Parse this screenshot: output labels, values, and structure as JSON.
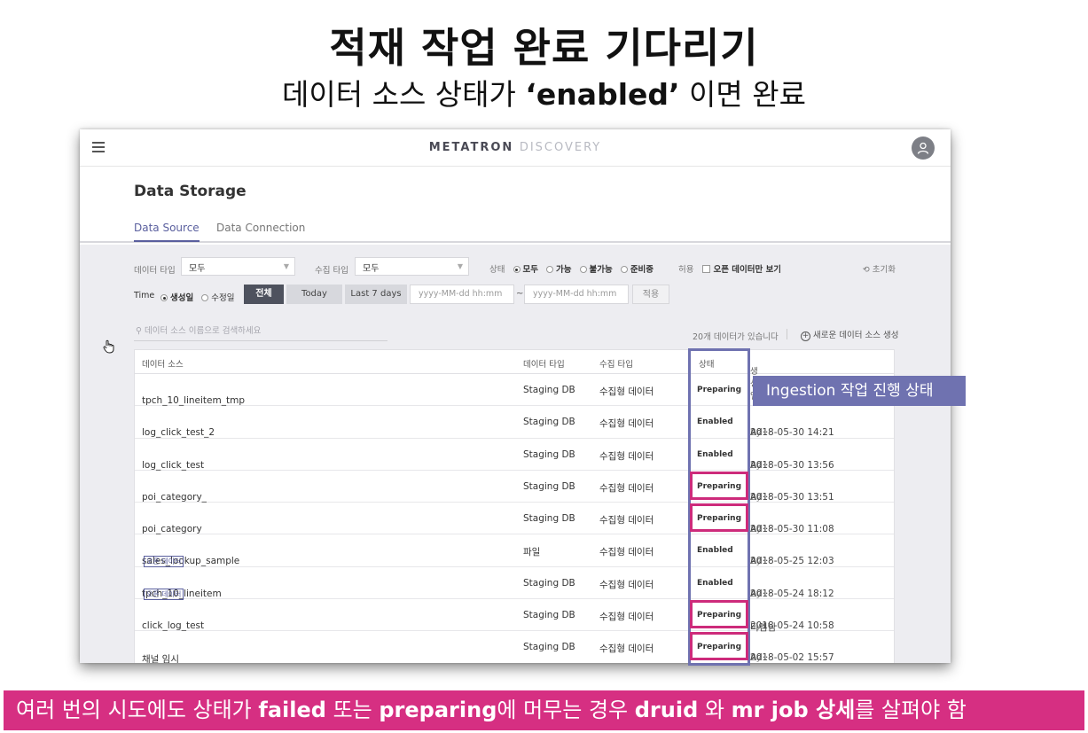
{
  "slide": {
    "title": "적재 작업 완료 기다리기",
    "subtitle_pre": "데이터 소스 상태가 ",
    "subtitle_bold": "‘enabled’",
    "subtitle_post": " 이면 완료",
    "callout": "Ingestion 작업 진행 상태",
    "banner": {
      "p1": "여러 번의 시도에도 상태가 ",
      "b1": "failed",
      "p2": " 또는 ",
      "b2": "preparing",
      "p3": "에 머무는 경우 ",
      "b3": "druid",
      "p4": " 와 ",
      "b4": "mr job 상세",
      "p5": "를 살펴야 함"
    }
  },
  "app": {
    "brand_main": "METATRON",
    "brand_sub": "DISCOVERY",
    "page_title": "Data Storage",
    "tabs": [
      "Data Source",
      "Data Connection"
    ],
    "filters": {
      "data_type_label": "데이터 타입",
      "data_type_value": "모두",
      "ingestion_type_label": "수집 타입",
      "ingestion_type_value": "모두",
      "status_label": "상태",
      "status_options": [
        "모두",
        "가능",
        "불가능",
        "준비중"
      ],
      "open_label": "허용",
      "open_checkbox_label": "오픈 데이터만 보기",
      "reset": "초기화",
      "time_label": "Time",
      "time_options": [
        "생성일",
        "수정일"
      ],
      "btn_all": "전체",
      "btn_today": "Today",
      "btn_last7": "Last 7 days",
      "date_from_placeholder": "yyyy-MM-dd   hh:mm",
      "date_to_placeholder": "yyyy-MM-dd   hh:mm",
      "tilde": "~",
      "btn_apply": "적용"
    },
    "search_placeholder": "데이터 소스 이름으로 검색하세요",
    "count_text": "20개 데이터가 있습니다",
    "new_source": "새로운 데이터 소스 생성",
    "table": {
      "headers": [
        "데이터 소스",
        "데이터 타입",
        "수집 타입",
        "상태",
        "생성일"
      ],
      "rows": [
        {
          "name": "tpch_10_lineitem_tmp",
          "badge": "",
          "type": "Staging DB",
          "ingestion": "수집형 데이터",
          "status": "Preparing",
          "date": "",
          "by": ""
        },
        {
          "name": "log_click_test_2",
          "badge": "",
          "type": "Staging DB",
          "ingestion": "수집형 데이터",
          "status": "Enabled",
          "date": "2018-05-30 14:21",
          "by": "Ad···"
        },
        {
          "name": "log_click_test",
          "badge": "",
          "type": "Staging DB",
          "ingestion": "수집형 데이터",
          "status": "Enabled",
          "date": "2018-05-30 13:56",
          "by": "Ad···"
        },
        {
          "name": "poi_category_",
          "badge": "",
          "type": "Staging DB",
          "ingestion": "수집형 데이터",
          "status": "Preparing",
          "date": "2018-05-30 13:51",
          "by": "Ad···"
        },
        {
          "name": "poi_category",
          "badge": "",
          "type": "Staging DB",
          "ingestion": "수집형 데이터",
          "status": "Preparing",
          "date": "2018-05-30 11:08",
          "by": "Ad···"
        },
        {
          "name": "sales_lookup_sample",
          "badge": "오픈 데이터",
          "type": "파일",
          "ingestion": "수집형 데이터",
          "status": "Enabled",
          "date": "2018-05-25 12:03",
          "by": "Ad···"
        },
        {
          "name": "tpch_10_lineitem",
          "badge": "오픈 데이터",
          "type": "Staging DB",
          "ingestion": "수집형 데이터",
          "status": "Enabled",
          "date": "2018-05-24 18:12",
          "by": "Ad···"
        },
        {
          "name": "click_log_test",
          "badge": "",
          "type": "Staging DB",
          "ingestion": "수집형 데이터",
          "status": "Preparing",
          "date": "2018-05-24 10:58",
          "by": "티엠님"
        },
        {
          "name": "채널 임시",
          "badge": "",
          "type": "Staging DB",
          "ingestion": "수집형 데이터",
          "status": "Preparing",
          "date": "2018-05-02 15:57",
          "by": "Ad···"
        }
      ]
    },
    "by_word": "by",
    "colors": {
      "accent": "#5a5f9e",
      "highlight_blue": "#6f72b0",
      "highlight_pink": "#cd2b7b",
      "banner": "#d62f82"
    }
  }
}
